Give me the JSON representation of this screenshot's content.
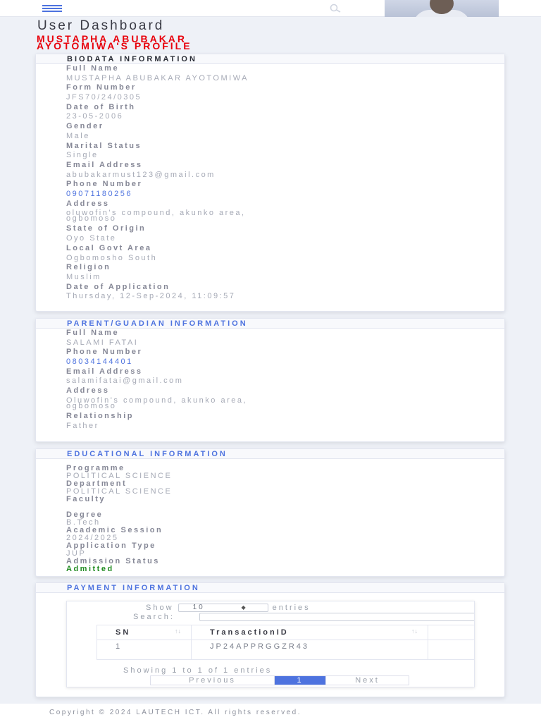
{
  "header": {
    "menu_icon": "hamburger-icon",
    "search_icon": "search-icon",
    "avatar": "user-photo"
  },
  "page": {
    "title": "User Dashboard",
    "profile_title_line1": "MUSTAPHA ABUBAKAR",
    "profile_title_line2": "AYOTOMIWA'S PROFILE"
  },
  "biodata": {
    "heading": "BIODATA INFORMATION",
    "fields": [
      {
        "label": "Full Name",
        "value": "MUSTAPHA ABUBAKAR AYOTOMIWA"
      },
      {
        "label": "Form Number",
        "value": "JFS70/24/0305"
      },
      {
        "label": "Date of Birth",
        "value": "23-05-2006"
      },
      {
        "label": "Gender",
        "value": "Male"
      },
      {
        "label": "Marital Status",
        "value": "Single"
      },
      {
        "label": "Email Address",
        "value": "abubakarmust123@gmail.com"
      },
      {
        "label": "Phone Number",
        "value": "09071180256"
      },
      {
        "label": "Address",
        "value_line1": "oluwofin's compound, akunko area,",
        "value_line2": "ogbomoso"
      },
      {
        "label": "State of Origin",
        "value": "Oyo State"
      },
      {
        "label": "Local Govt Area",
        "value": "Ogbomosho South"
      },
      {
        "label": "Religion",
        "value": "Muslim"
      },
      {
        "label": "Date of Application",
        "value": "Thursday, 12-Sep-2024, 11:09:57"
      }
    ]
  },
  "guardian": {
    "heading": "PARENT/GUADIAN INFORMATION",
    "fields": [
      {
        "label": "Full Name",
        "value": "SALAMI FATAI"
      },
      {
        "label": "Phone Number",
        "value": "08034144401"
      },
      {
        "label": "Email Address",
        "value": "salamifatai@gmail.com"
      },
      {
        "label": "Address",
        "value_line1": "Oluwofin's compound, akunko area,",
        "value_line2": "ogbomoso"
      },
      {
        "label": "Relationship",
        "value": "Father"
      }
    ]
  },
  "education": {
    "heading": "EDUCATIONAL INFORMATION",
    "fields": [
      {
        "label": "Programme",
        "value": "POLITICAL SCIENCE"
      },
      {
        "label": "Department",
        "value": "POLITICAL SCIENCE"
      },
      {
        "label": "Faculty",
        "value": ""
      },
      {
        "label": "Degree",
        "value": "B.Tech"
      },
      {
        "label": "Academic Session",
        "value": "2024/2025"
      },
      {
        "label": "Application Type",
        "value": "JUP"
      },
      {
        "label": "Admission Status",
        "value": "Admitted"
      }
    ],
    "status_color": "#1f8a1f"
  },
  "payment": {
    "heading": "PAYMENT INFORMATION",
    "show_label": "Show",
    "entries_value": "10",
    "entries_label": "entries",
    "search_label": "Search:",
    "columns": [
      "SN",
      "TransactionID"
    ],
    "rows": [
      {
        "sn": "1",
        "transaction_id": "JP24APPRGGZR43"
      }
    ],
    "info": "Showing 1 to 1 of 1 entries",
    "previous": "Previous",
    "current_page": "1",
    "next": "Next"
  },
  "footer": {
    "copyright": "Copyright © 2024 LAUTECH ICT. All rights reserved."
  },
  "colors": {
    "accent": "#4e73df",
    "profile_title": "#e8000b"
  }
}
